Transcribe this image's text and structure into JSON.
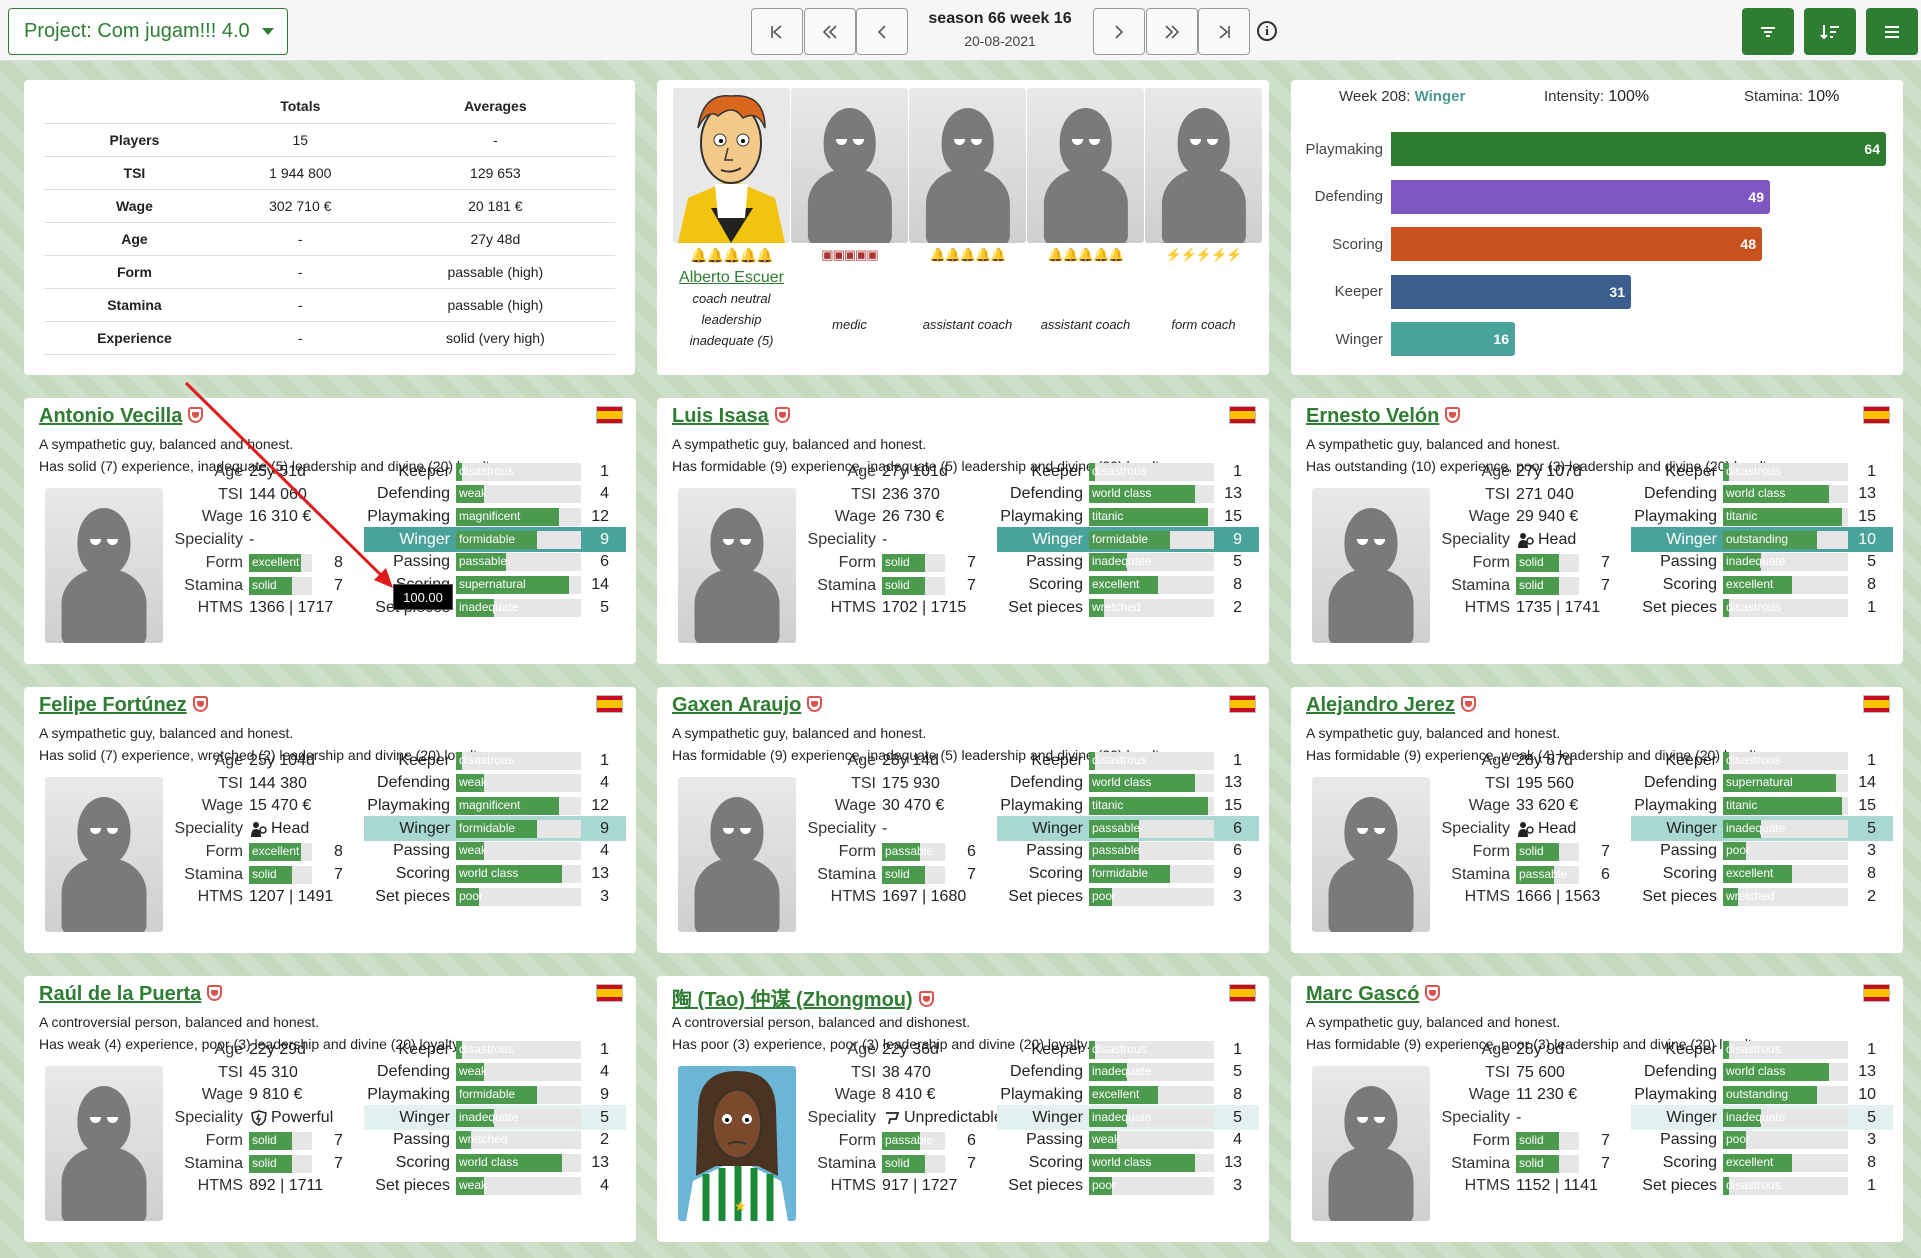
{
  "topbar": {
    "project": "Project: Com jugam!!! 4.0",
    "season": "season 66 week 16",
    "date": "20-08-2021",
    "nav_icons": [
      "first-icon",
      "prev-fast-icon",
      "prev-icon",
      "next-icon",
      "next-fast-icon",
      "last-icon"
    ],
    "right_icons": [
      "filter-icon",
      "sort-icon",
      "menu-icon"
    ]
  },
  "totals": {
    "headers": [
      "",
      "Totals",
      "Averages"
    ],
    "rows": [
      {
        "label": "Players",
        "total": "15",
        "avg": "-"
      },
      {
        "label": "TSI",
        "total": "1 944 800",
        "avg": "129 653"
      },
      {
        "label": "Wage",
        "total": "302 710 €",
        "avg": "20 181 €"
      },
      {
        "label": "Age",
        "total": "-",
        "avg": "27y 48d"
      },
      {
        "label": "Form",
        "total": "-",
        "avg": "passable (high)"
      },
      {
        "label": "Stamina",
        "total": "-",
        "avg": "passable (high)"
      },
      {
        "label": "Experience",
        "total": "-",
        "avg": "solid (very high)"
      }
    ]
  },
  "staff": {
    "coach_name": "Alberto Escuer",
    "coach_lines": [
      "coach neutral",
      "leadership",
      "inadequate (5)"
    ],
    "roles": [
      "medic",
      "assistant coach",
      "assistant coach",
      "form coach"
    ]
  },
  "training": {
    "week_label": "Week 208:",
    "week_value": "Winger",
    "intensity_label": "Intensity:",
    "intensity_value": "100%",
    "stamina_label": "Stamina:",
    "stamina_value": "10%",
    "bars": [
      {
        "label": "Playmaking",
        "value": 64,
        "color": "#2e7d32"
      },
      {
        "label": "Defending",
        "value": 49,
        "color": "#7e57c2"
      },
      {
        "label": "Scoring",
        "value": 48,
        "color": "#c8521f"
      },
      {
        "label": "Keeper",
        "value": 31,
        "color": "#3a5f8f"
      },
      {
        "label": "Winger",
        "value": 16,
        "color": "#4aa39a"
      }
    ]
  },
  "tooltip": "100.00",
  "labels": {
    "age": "Age",
    "tsi": "TSI",
    "wage": "Wage",
    "speciality": "Speciality",
    "form": "Form",
    "stamina": "Stamina",
    "htms": "HTMS",
    "keeper": "Keeper",
    "defending": "Defending",
    "playmaking": "Playmaking",
    "winger": "Winger",
    "passing": "Passing",
    "scoring": "Scoring",
    "setpieces": "Set pieces"
  },
  "players": [
    {
      "name": "Antonio Vecilla",
      "desc1": "A sympathetic guy, balanced and honest.",
      "desc2": "Has solid (7) experience, inadequate (5) leadership and divine (20) loyalty.",
      "age": "25y 51d",
      "tsi": "144 060",
      "wage": "16 310 €",
      "spec": "-",
      "form_t": "excellent",
      "form_n": 8,
      "sta_t": "solid",
      "sta_n": 7,
      "htms": "1366 | 1717",
      "skills": [
        [
          "disastrous",
          1
        ],
        [
          "weak",
          4
        ],
        [
          "magnificent",
          12
        ],
        [
          "formidable",
          9
        ],
        [
          "passable",
          6
        ],
        [
          "supernatural",
          14
        ],
        [
          "inadequate",
          5
        ]
      ],
      "winger_hl": "strong"
    },
    {
      "name": "Luis Isasa",
      "desc1": "A sympathetic guy, balanced and honest.",
      "desc2": "Has formidable (9) experience, inadequate (5) leadership and divine (20) loyalty.",
      "age": "27y 101d",
      "tsi": "236 370",
      "wage": "26 730 €",
      "spec": "-",
      "form_t": "solid",
      "form_n": 7,
      "sta_t": "solid",
      "sta_n": 7,
      "htms": "1702 | 1715",
      "skills": [
        [
          "disastrous",
          1
        ],
        [
          "world class",
          13
        ],
        [
          "titanic",
          15
        ],
        [
          "formidable",
          9
        ],
        [
          "inadequate",
          5
        ],
        [
          "excellent",
          8
        ],
        [
          "wretched",
          2
        ]
      ],
      "winger_hl": "strong"
    },
    {
      "name": "Ernesto Velón",
      "desc1": "A sympathetic guy, balanced and honest.",
      "desc2": "Has outstanding (10) experience, poor (3) leadership and divine (20) loyalty.",
      "age": "27y 107d",
      "tsi": "271 040",
      "wage": "29 940 €",
      "spec": "Head",
      "form_t": "solid",
      "form_n": 7,
      "sta_t": "solid",
      "sta_n": 7,
      "htms": "1735 | 1741",
      "skills": [
        [
          "disastrous",
          1
        ],
        [
          "world class",
          13
        ],
        [
          "titanic",
          15
        ],
        [
          "outstanding",
          10
        ],
        [
          "inadequate",
          5
        ],
        [
          "excellent",
          8
        ],
        [
          "disastrous",
          1
        ]
      ],
      "winger_hl": "strong"
    },
    {
      "name": "Felipe Fortúnez",
      "desc1": "A sympathetic guy, balanced and honest.",
      "desc2": "Has solid (7) experience, wretched (2) leadership and divine (20) loyalty.",
      "age": "25y 104d",
      "tsi": "144 380",
      "wage": "15 470 €",
      "spec": "Head",
      "form_t": "excellent",
      "form_n": 8,
      "sta_t": "solid",
      "sta_n": 7,
      "htms": "1207 | 1491",
      "skills": [
        [
          "disastrous",
          1
        ],
        [
          "weak",
          4
        ],
        [
          "magnificent",
          12
        ],
        [
          "formidable",
          9
        ],
        [
          "weak",
          4
        ],
        [
          "world class",
          13
        ],
        [
          "poor",
          3
        ]
      ],
      "winger_hl": "light"
    },
    {
      "name": "Gaxen Araujo",
      "desc1": "A sympathetic guy, balanced and honest.",
      "desc2": "Has formidable (9) experience, inadequate (5) leadership and divine (20) loyalty.",
      "age": "28y 14d",
      "tsi": "175 930",
      "wage": "30 470 €",
      "spec": "-",
      "form_t": "passable",
      "form_n": 6,
      "sta_t": "solid",
      "sta_n": 7,
      "htms": "1697 | 1680",
      "skills": [
        [
          "disastrous",
          1
        ],
        [
          "world class",
          13
        ],
        [
          "titanic",
          15
        ],
        [
          "passable",
          6
        ],
        [
          "passable",
          6
        ],
        [
          "formidable",
          9
        ],
        [
          "poor",
          3
        ]
      ],
      "winger_hl": "light"
    },
    {
      "name": "Alejandro Jerez",
      "desc1": "A sympathetic guy, balanced and honest.",
      "desc2": "Has formidable (9) experience, weak (4) leadership and divine (20) loyalty.",
      "age": "28y 87d",
      "tsi": "195 560",
      "wage": "33 620 €",
      "spec": "Head",
      "form_t": "solid",
      "form_n": 7,
      "sta_t": "passable",
      "sta_n": 6,
      "htms": "1666 | 1563",
      "skills": [
        [
          "disastrous",
          1
        ],
        [
          "supernatural",
          14
        ],
        [
          "titanic",
          15
        ],
        [
          "inadequate",
          5
        ],
        [
          "poor",
          3
        ],
        [
          "excellent",
          8
        ],
        [
          "wretched",
          2
        ]
      ],
      "winger_hl": "light"
    },
    {
      "name": "Raúl de la Puerta",
      "desc1": "A controversial person, balanced and honest.",
      "desc2": "Has weak (4) experience, poor (3) leadership and divine (20) loyalty.",
      "age": "22y 29d",
      "tsi": "45 310",
      "wage": "9 810 €",
      "spec": "Powerful",
      "form_t": "solid",
      "form_n": 7,
      "sta_t": "solid",
      "sta_n": 7,
      "htms": "892 | 1711",
      "skills": [
        [
          "disastrous",
          1
        ],
        [
          "weak",
          4
        ],
        [
          "formidable",
          9
        ],
        [
          "inadequate",
          5
        ],
        [
          "wretched",
          2
        ],
        [
          "world class",
          13
        ],
        [
          "weak",
          4
        ]
      ],
      "winger_hl": "pale"
    },
    {
      "name": "陶 (Tao) 仲谋 (Zhongmou)",
      "desc1": "A controversial person, balanced and dishonest.",
      "desc2": "Has poor (3) experience, poor (3) leadership and divine (20) loyalty.",
      "age": "22y 36d",
      "tsi": "38 470",
      "wage": "8 410 €",
      "spec": "Unpredictable",
      "form_t": "passable",
      "form_n": 6,
      "sta_t": "solid",
      "sta_n": 7,
      "htms": "917 | 1727",
      "skills": [
        [
          "disastrous",
          1
        ],
        [
          "inadequate",
          5
        ],
        [
          "excellent",
          8
        ],
        [
          "inadequate",
          5
        ],
        [
          "weak",
          4
        ],
        [
          "world class",
          13
        ],
        [
          "poor",
          3
        ]
      ],
      "winger_hl": "pale"
    },
    {
      "name": "Marc Gascó",
      "desc1": "A sympathetic guy, balanced and honest.",
      "desc2": "Has formidable (9) experience, poor (3) leadership and divine (20) loyalty.",
      "age": "28y 9d",
      "tsi": "75 600",
      "wage": "11 230 €",
      "spec": "-",
      "form_t": "solid",
      "form_n": 7,
      "sta_t": "solid",
      "sta_n": 7,
      "htms": "1152 | 1141",
      "skills": [
        [
          "disastrous",
          1
        ],
        [
          "world class",
          13
        ],
        [
          "outstanding",
          10
        ],
        [
          "inadequate",
          5
        ],
        [
          "poor",
          3
        ],
        [
          "excellent",
          8
        ],
        [
          "disastrous",
          1
        ]
      ],
      "winger_hl": "pale"
    }
  ]
}
